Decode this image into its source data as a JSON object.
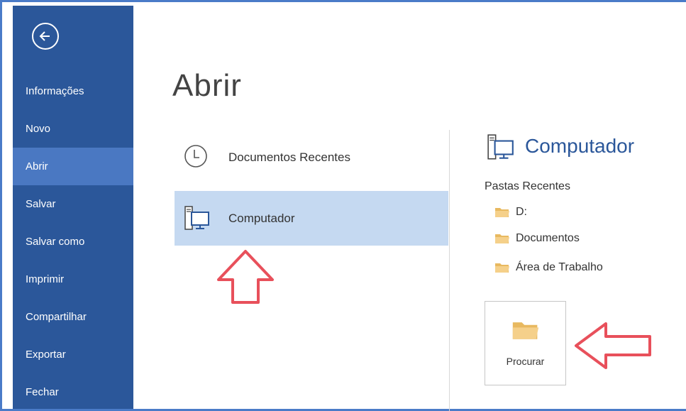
{
  "sidebar": {
    "items": [
      {
        "label": "Informações"
      },
      {
        "label": "Novo"
      },
      {
        "label": "Abrir"
      },
      {
        "label": "Salvar"
      },
      {
        "label": "Salvar como"
      },
      {
        "label": "Imprimir"
      },
      {
        "label": "Compartilhar"
      },
      {
        "label": "Exportar"
      },
      {
        "label": "Fechar"
      }
    ],
    "active_index": 2,
    "background_color": "#2b579a",
    "active_color": "#4a78c2"
  },
  "main": {
    "title": "Abrir",
    "places": [
      {
        "label": "Documentos Recentes",
        "icon": "clock-icon"
      },
      {
        "label": "Computador",
        "icon": "computer-icon",
        "selected": true
      }
    ]
  },
  "right_panel": {
    "title": "Computador",
    "icon": "computer-icon",
    "recent_heading": "Pastas Recentes",
    "recent_folders": [
      {
        "label": "D:",
        "icon": "folder-icon"
      },
      {
        "label": "Documentos",
        "icon": "folder-icon"
      },
      {
        "label": "Área de Trabalho",
        "icon": "folder-icon"
      }
    ],
    "browse_label": "Procurar"
  },
  "annotations": {
    "arrow_color": "#e8505b"
  }
}
